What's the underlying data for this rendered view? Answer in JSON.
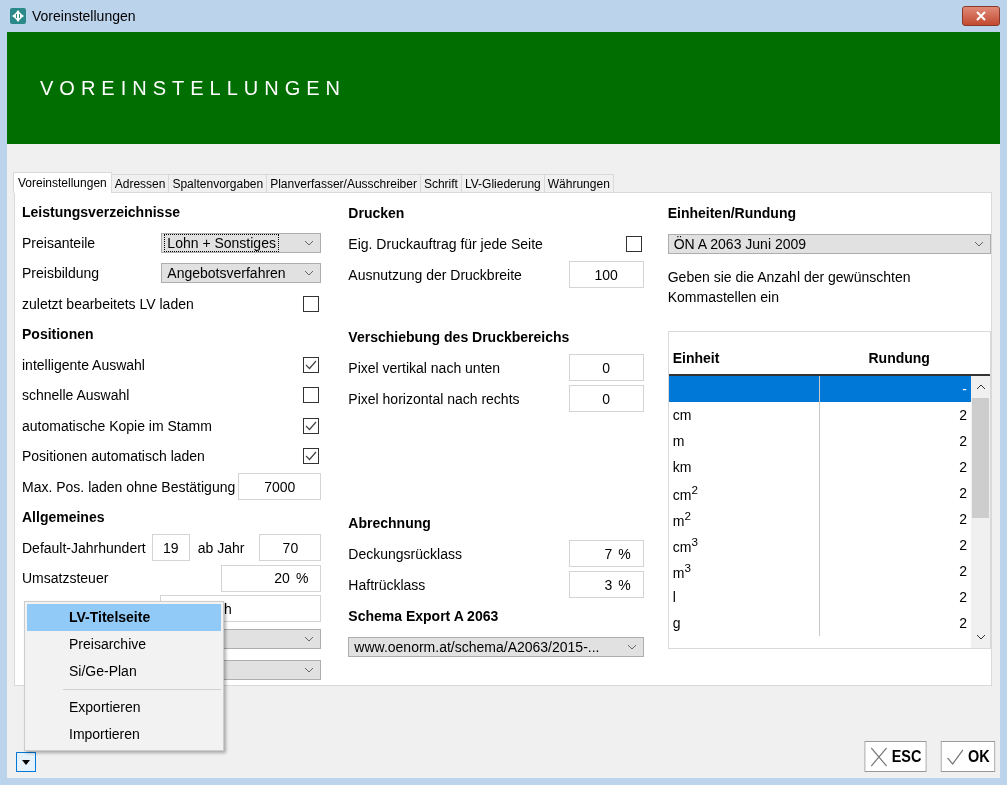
{
  "window": {
    "title": "Voreinstellungen"
  },
  "banner": {
    "title": "VOREINSTELLUNGEN"
  },
  "tabs": [
    {
      "label": "Voreinstellungen",
      "selected": true
    },
    {
      "label": "Adressen",
      "selected": false
    },
    {
      "label": "Spaltenvorgaben",
      "selected": false
    },
    {
      "label": "Planverfasser/Ausschreiber",
      "selected": false
    },
    {
      "label": "Schrift",
      "selected": false
    },
    {
      "label": "LV-Gliederung",
      "selected": false
    },
    {
      "label": "Währungen",
      "selected": false
    }
  ],
  "left": [
    {
      "heading": "Leistungsverzeichnisse",
      "rows": [
        {
          "kind": "dropdown",
          "label": "Preisanteile",
          "value": "Lohn + Sonstiges",
          "focused": true
        },
        {
          "kind": "dropdown",
          "label": "Preisbildung",
          "value": "Angebotsverfahren",
          "focused": false
        },
        {
          "kind": "checkbox",
          "label": "zuletzt bearbeitets LV laden",
          "checked": false
        }
      ]
    },
    {
      "heading": "Positionen",
      "rows": [
        {
          "kind": "checkbox",
          "label": "intelligente Auswahl",
          "checked": true
        },
        {
          "kind": "checkbox",
          "label": "schnelle Auswahl",
          "checked": false
        },
        {
          "kind": "checkbox",
          "label": "automatische Kopie im Stamm",
          "checked": true
        },
        {
          "kind": "checkbox",
          "label": "Positionen automatisch laden",
          "checked": true
        },
        {
          "kind": "field",
          "label": "Max. Pos. laden ohne Bestätigung",
          "value": "7000"
        }
      ]
    },
    {
      "heading": "Allgemeines",
      "rows": [
        {
          "kind": "pair",
          "label": "Default-Jahrhundert",
          "value": "19",
          "label2": "ab Jahr",
          "value2": "70"
        },
        {
          "kind": "field",
          "label": "Umsatzsteuer",
          "value": "20",
          "unit": "%"
        },
        {
          "kind": "field",
          "value": "h"
        },
        {
          "kind": "dropdown"
        },
        {
          "kind": "dropdown"
        }
      ]
    }
  ],
  "middle": [
    {
      "heading": "Drucken",
      "rows": [
        {
          "kind": "checkbox",
          "label": "Eig. Druckauftrag für jede Seite",
          "checked": false
        },
        {
          "kind": "field",
          "label": "Ausnutzung der Druckbreite",
          "value": "100"
        }
      ]
    },
    {
      "heading": "Verschiebung des Druckbereichs",
      "rows": [
        {
          "kind": "field",
          "label": "Pixel vertikal nach unten",
          "value": "0"
        },
        {
          "kind": "field",
          "label": "Pixel horizontal nach rechts",
          "value": "0"
        }
      ]
    },
    {
      "heading": "Abrechnung",
      "rows": [
        {
          "kind": "field",
          "label": "Deckungsrücklass",
          "value": "7",
          "unit": "%"
        },
        {
          "kind": "field",
          "label": "Haftrücklass",
          "value": "3",
          "unit": "%"
        }
      ]
    },
    {
      "heading": "Schema Export A 2063",
      "rows": [
        {
          "kind": "combo",
          "value": "www.oenorm.at/schema/A2063/2015-...",
          "focused": false
        }
      ]
    }
  ],
  "right": {
    "heading": "Einheiten/Rundung",
    "dropdown": "ÖN A 2063 Juni 2009",
    "hint": "Geben sie die Anzahl der gewünschten Kommastellen ein",
    "table": {
      "columns": [
        "Einheit",
        "Rundung"
      ],
      "rows": [
        {
          "rounding": "-",
          "selected": true
        },
        {
          "unit": "cm",
          "rounding": "2",
          "selected": false
        },
        {
          "unit": "m",
          "rounding": "2",
          "selected": false
        },
        {
          "unit": "km",
          "rounding": "2",
          "selected": false
        },
        {
          "unit": "cm$^{2}$",
          "rounding": "2",
          "selected": false
        },
        {
          "unit": "m$^{2}$",
          "rounding": "2",
          "selected": false
        },
        {
          "unit": "cm$^{3}$",
          "rounding": "2",
          "selected": false
        },
        {
          "unit": "m$^{3}$",
          "rounding": "2",
          "selected": false
        },
        {
          "unit": "l",
          "rounding": "2",
          "selected": false
        },
        {
          "unit": "g",
          "rounding": "2",
          "selected": false
        }
      ]
    }
  },
  "menu": {
    "items": [
      {
        "kind": "item",
        "label": "LV-Titelseite",
        "selected": true
      },
      {
        "kind": "item",
        "label": "Preisarchive",
        "selected": false
      },
      {
        "kind": "item",
        "label": "Si/Ge-Plan",
        "selected": false
      },
      {
        "kind": "separator"
      },
      {
        "kind": "item",
        "label": "Exportieren",
        "selected": false
      },
      {
        "kind": "item",
        "label": "Importieren",
        "selected": false
      }
    ]
  },
  "buttons": [
    {
      "kind": "cancel",
      "label": "ESC"
    },
    {
      "kind": "ok",
      "label": "OK"
    }
  ]
}
